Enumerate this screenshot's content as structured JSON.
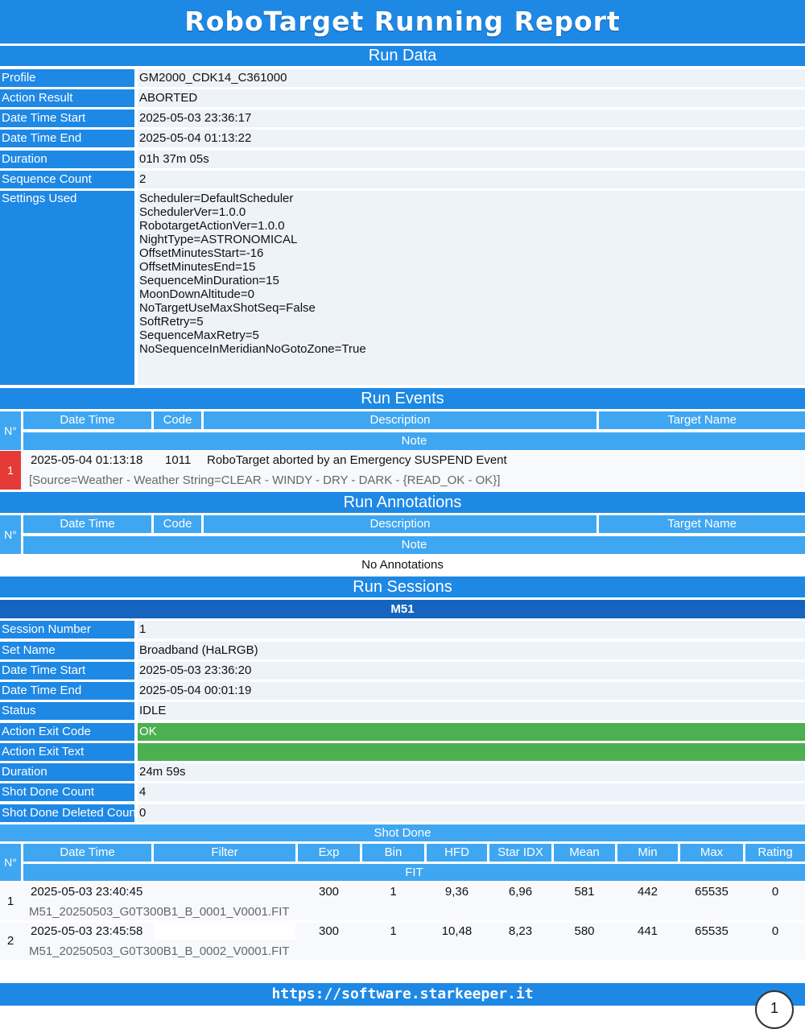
{
  "title": "RoboTarget Running Report",
  "run_data": {
    "heading": "Run Data",
    "rows": [
      {
        "label": "Profile",
        "value": "GM2000_CDK14_C361000"
      },
      {
        "label": "Action Result",
        "value": "ABORTED"
      },
      {
        "label": "Date Time Start",
        "value": "2025-05-03 23:36:17"
      },
      {
        "label": "Date Time End",
        "value": "2025-05-04 01:13:22"
      },
      {
        "label": "Duration",
        "value": "01h 37m 05s"
      },
      {
        "label": "Sequence Count",
        "value": "2"
      }
    ],
    "settings_label": "Settings Used",
    "settings": [
      "Scheduler=DefaultScheduler",
      "SchedulerVer=1.0.0",
      "RobotargetActionVer=1.0.0",
      "NightType=ASTRONOMICAL",
      "OffsetMinutesStart=-16",
      "OffsetMinutesEnd=15",
      "SequenceMinDuration=15",
      "MoonDownAltitude=0",
      "NoTargetUseMaxShotSeq=False",
      "SoftRetry=5",
      "SequenceMaxRetry=5",
      "NoSequenceInMeridianNoGotoZone=True"
    ]
  },
  "event_headers": {
    "n": "N°",
    "date_time": "Date Time",
    "code": "Code",
    "description": "Description",
    "target_name": "Target Name",
    "note": "Note"
  },
  "run_events": {
    "heading": "Run Events",
    "rows": [
      {
        "n": "1",
        "date_time": "2025-05-04 01:13:18",
        "code": "1011",
        "description": "RoboTarget aborted by an Emergency SUSPEND Event",
        "note": "[Source=Weather - Weather String=CLEAR - WINDY - DRY - DARK - {READ_OK - OK}]"
      }
    ]
  },
  "run_annotations": {
    "heading": "Run Annotations",
    "empty_text": "No Annotations"
  },
  "run_sessions": {
    "heading": "Run Sessions",
    "target": "M51",
    "rows": [
      {
        "label": "Session Number",
        "value": "1"
      },
      {
        "label": "Set Name",
        "value": "Broadband (HaLRGB)"
      },
      {
        "label": "Date Time Start",
        "value": "2025-05-03 23:36:20"
      },
      {
        "label": "Date Time End",
        "value": "2025-05-04 00:01:19"
      },
      {
        "label": "Status",
        "value": "IDLE"
      },
      {
        "label": "Action Exit Code",
        "value": "OK"
      },
      {
        "label": "Action Exit Text",
        "value": ""
      },
      {
        "label": "Duration",
        "value": "24m 59s"
      },
      {
        "label": "Shot Done Count",
        "value": "4"
      },
      {
        "label": "Shot Done Deleted Count",
        "value": "0"
      }
    ],
    "shot_done": {
      "heading": "Shot Done",
      "headers": {
        "n": "N°",
        "date_time": "Date Time",
        "filter": "Filter",
        "exp": "Exp",
        "bin": "Bin",
        "hfd": "HFD",
        "star_idx": "Star IDX",
        "mean": "Mean",
        "min": "Min",
        "max": "Max",
        "rating": "Rating",
        "fit": "FIT"
      },
      "rows": [
        {
          "n": "1",
          "date_time": "2025-05-03 23:40:45",
          "filter": "",
          "exp": "300",
          "bin": "1",
          "hfd": "9,36",
          "star_idx": "6,96",
          "mean": "581",
          "min": "442",
          "max": "65535",
          "rating": "0",
          "fit": "M51_20250503_G0T300B1_B_0001_V0001.FIT"
        },
        {
          "n": "2",
          "date_time": "2025-05-03 23:45:58",
          "filter": "",
          "exp": "300",
          "bin": "1",
          "hfd": "10,48",
          "star_idx": "8,23",
          "mean": "580",
          "min": "441",
          "max": "65535",
          "rating": "0",
          "fit": "M51_20250503_G0T300B1_B_0002_V0001.FIT"
        }
      ]
    }
  },
  "footer": {
    "url": "https://software.starkeeper.it",
    "page": "1"
  },
  "colors": {
    "header_blue": "#1e88e5",
    "light_blue": "#3fa6f2",
    "dark_blue": "#1565c0",
    "ok_green": "#4caf50",
    "alert_red": "#e53935"
  }
}
